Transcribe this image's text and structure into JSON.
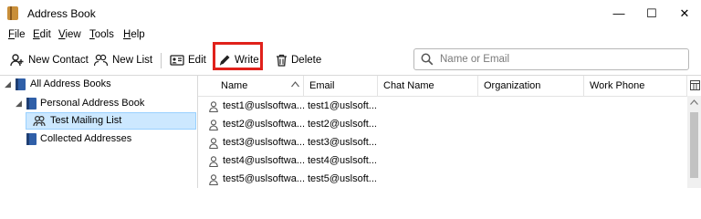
{
  "window": {
    "title": "Address Book",
    "controls": [
      "—",
      "☐",
      "✕"
    ]
  },
  "menu": [
    {
      "label": "File",
      "mnemonic": "F",
      "rest": "ile"
    },
    {
      "label": "Edit",
      "mnemonic": "E",
      "rest": "dit"
    },
    {
      "label": "View",
      "mnemonic": "V",
      "rest": "iew"
    },
    {
      "label": "Tools",
      "mnemonic": "T",
      "rest": "ools"
    },
    {
      "label": "Help",
      "mnemonic": "H",
      "rest": "elp"
    }
  ],
  "toolbar": {
    "new_contact": "New Contact",
    "new_list": "New List",
    "edit": "Edit",
    "write": "Write",
    "delete": "Delete",
    "highlighted": "Write",
    "highlight_color": "#e0211b"
  },
  "search": {
    "placeholder": "Name or Email"
  },
  "tree": {
    "items": [
      {
        "label": "All Address Books",
        "expanded": true
      },
      {
        "label": "Personal Address Book",
        "expanded": true
      },
      {
        "label": "Test Mailing List",
        "selected": true
      },
      {
        "label": "Collected Addresses"
      }
    ]
  },
  "columns": [
    "Name",
    "Email",
    "Chat Name",
    "Organization",
    "Work Phone"
  ],
  "rows": [
    {
      "name": "test1@uslsoftwa...",
      "email": "test1@uslsoft..."
    },
    {
      "name": "test2@uslsoftwa...",
      "email": "test2@uslsoft..."
    },
    {
      "name": "test3@uslsoftwa...",
      "email": "test3@uslsoft..."
    },
    {
      "name": "test4@uslsoftwa...",
      "email": "test4@uslsoft..."
    },
    {
      "name": "test5@uslsoftwa...",
      "email": "test5@uslsoft..."
    }
  ],
  "colors": {
    "selection": "#cce8ff",
    "book": "#2f5fa8"
  }
}
